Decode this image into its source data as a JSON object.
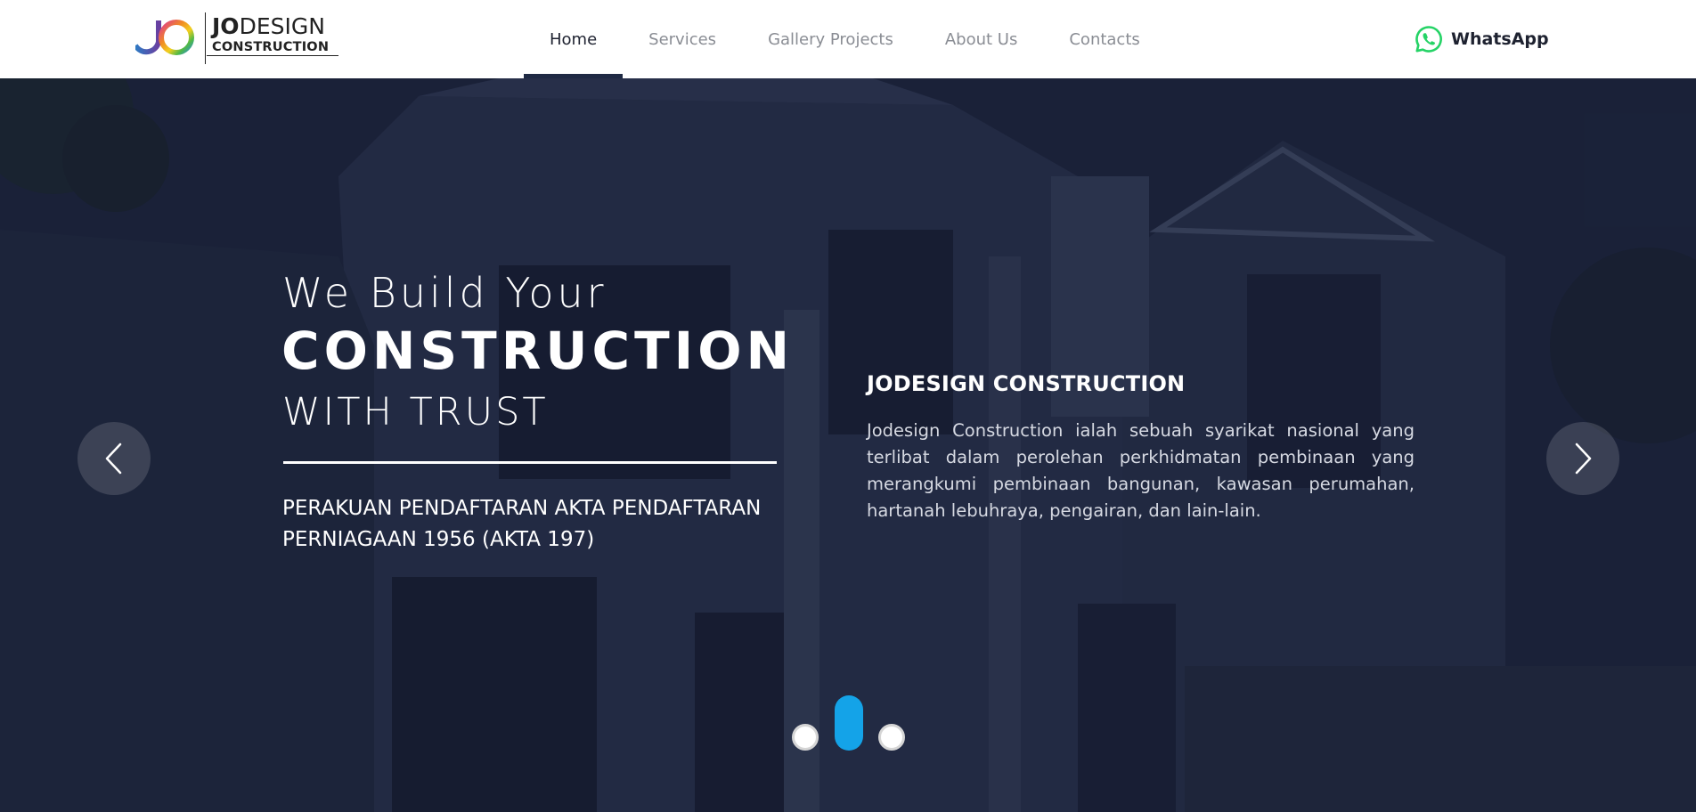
{
  "brand": {
    "logo_word_bold": "JO",
    "logo_word_light": "DESIGN",
    "logo_sub": "CONSTRUCTION"
  },
  "nav": {
    "items": [
      {
        "label": "Home",
        "active": true
      },
      {
        "label": "Services",
        "active": false
      },
      {
        "label": "Gallery Projects",
        "active": false
      },
      {
        "label": "About Us",
        "active": false
      },
      {
        "label": "Contacts",
        "active": false
      }
    ]
  },
  "whatsapp": {
    "label": "WhatsApp",
    "icon": "whatsapp-icon",
    "color": "#25D366"
  },
  "hero": {
    "line1": "We Build Your",
    "line2": "CONSTRUCTION",
    "line3": "WITH TRUST",
    "registration": "PERAKUAN PENDAFTARAN AKTA PENDAFTARAN PERNIAGAAN 1956 (AKTA 197)",
    "company_title": "JODESIGN CONSTRUCTION",
    "company_desc": "Jodesign Construction ialah sebuah syarikat nasional yang terlibat dalam perolehan perkhidmatan pembinaan yang merangkumi pembinaan bangunan, kawasan perumahan, hartanah lebuhraya, pengairan, dan lain-lain."
  },
  "slider": {
    "prev_icon": "chevron-left-icon",
    "next_icon": "chevron-right-icon",
    "slide_count": 3,
    "active_slide": 2,
    "accent": "#14A3E8"
  }
}
